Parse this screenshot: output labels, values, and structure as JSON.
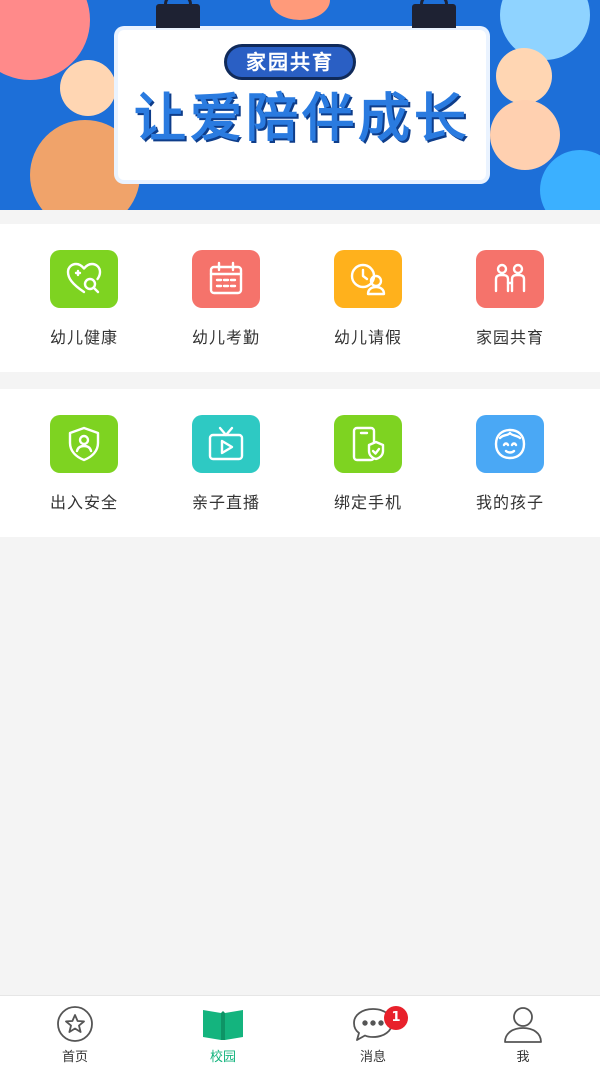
{
  "banner": {
    "tag": "家园共育",
    "slogan": "让爱陪伴成长"
  },
  "grid1": [
    {
      "label": "幼儿健康",
      "icon": "heart-search-icon",
      "color": "#7ed321"
    },
    {
      "label": "幼儿考勤",
      "icon": "calendar-icon",
      "color": "#f5736b"
    },
    {
      "label": "幼儿请假",
      "icon": "clock-user-icon",
      "color": "#ffb11c"
    },
    {
      "label": "家园共育",
      "icon": "parents-icon",
      "color": "#f5736b"
    }
  ],
  "grid2": [
    {
      "label": "出入安全",
      "icon": "shield-user-icon",
      "color": "#7ed321"
    },
    {
      "label": "亲子直播",
      "icon": "video-play-icon",
      "color": "#2ec9c3"
    },
    {
      "label": "绑定手机",
      "icon": "phone-shield-icon",
      "color": "#7ed321"
    },
    {
      "label": "我的孩子",
      "icon": "baby-face-icon",
      "color": "#4aa8f5"
    }
  ],
  "tabbar": {
    "home": "首页",
    "campus": "校园",
    "messages": "消息",
    "messages_badge": "1",
    "me": "我",
    "active_color": "#14b47e"
  }
}
